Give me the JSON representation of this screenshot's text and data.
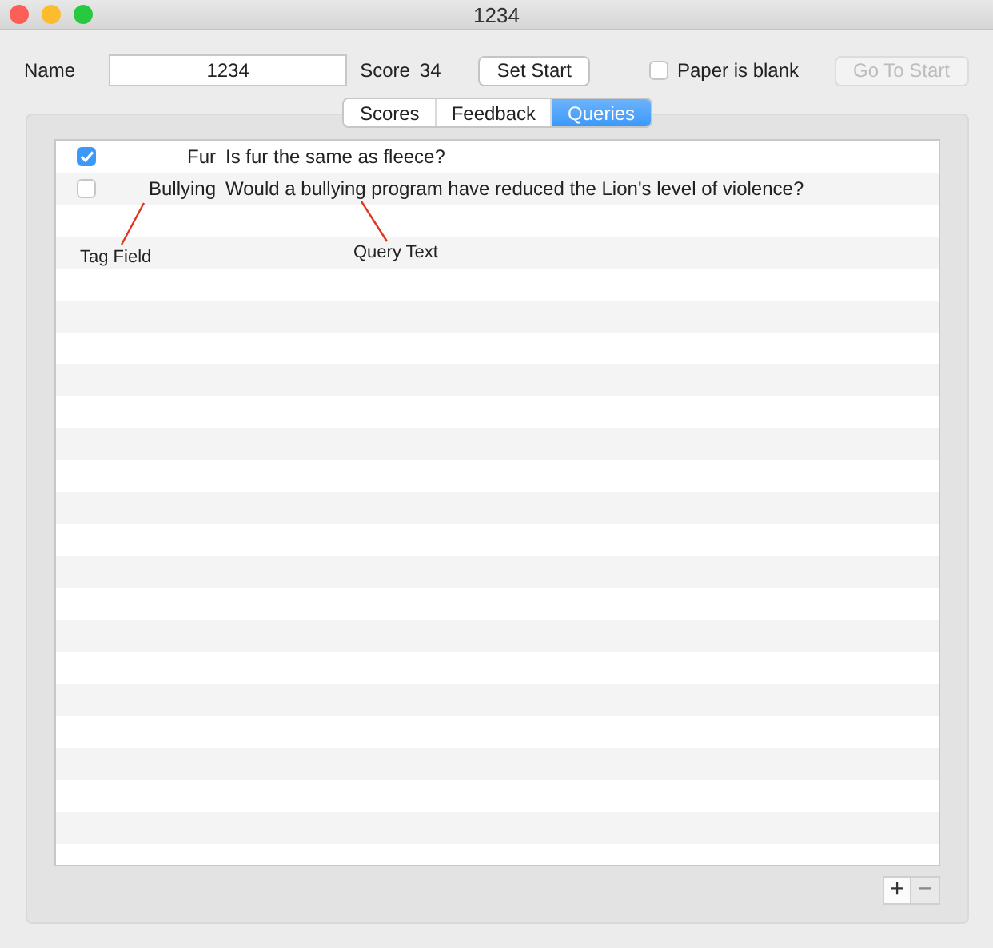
{
  "window": {
    "title": "1234"
  },
  "toolbar": {
    "name_label": "Name",
    "name_value": "1234",
    "score_label": "Score",
    "score_value": "34",
    "set_start_button": "Set Start",
    "paper_blank": {
      "label": "Paper is blank",
      "checked": false
    },
    "go_to_start_button": {
      "label": "Go To Start",
      "disabled": true
    }
  },
  "tabs": [
    {
      "label": "Scores",
      "selected": false
    },
    {
      "label": "Feedback",
      "selected": false
    },
    {
      "label": "Queries",
      "selected": true
    }
  ],
  "queries": [
    {
      "checked": true,
      "tag": "Fur",
      "text": "Is fur the same as fleece?"
    },
    {
      "checked": false,
      "tag": "Bullying",
      "text": "Would a bullying program have reduced the Lion's level of violence?"
    }
  ],
  "annotations": [
    {
      "text": "Tag Field"
    },
    {
      "text": "Query Text"
    }
  ],
  "table_buttons": [
    {
      "label": "+",
      "disabled": false
    },
    {
      "label": "−",
      "disabled": true
    }
  ]
}
